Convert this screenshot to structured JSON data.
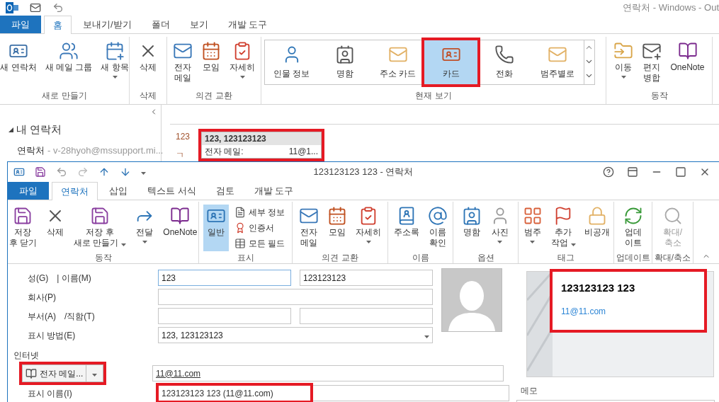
{
  "main_window": {
    "title": "연락처 - Windows - Out",
    "tabs": [
      {
        "label": "파일",
        "kind": "file",
        "selected": false
      },
      {
        "label": "홈",
        "kind": "tab",
        "selected": true
      },
      {
        "label": "보내기/받기",
        "kind": "tab",
        "selected": false
      },
      {
        "label": "폴더",
        "kind": "tab",
        "selected": false
      },
      {
        "label": "보기",
        "kind": "tab",
        "selected": false
      },
      {
        "label": "개발 도구",
        "kind": "tab",
        "selected": false
      }
    ],
    "ribbon_groups": [
      {
        "label": "새로 만들기",
        "kind": "buttons",
        "buttons": [
          {
            "lines": [
              "새 연락처"
            ],
            "dropdown": false
          },
          {
            "lines": [
              "새 메일 그룹"
            ],
            "dropdown": false
          },
          {
            "lines": [
              "새 항목"
            ],
            "dropdown": true
          }
        ]
      },
      {
        "label": "삭제",
        "kind": "buttons",
        "buttons": [
          {
            "lines": [
              "삭제"
            ],
            "dropdown": false
          }
        ]
      },
      {
        "label": "의견 교환",
        "kind": "buttons",
        "buttons": [
          {
            "lines": [
              "전자",
              "메일"
            ],
            "dropdown": false
          },
          {
            "lines": [
              "모임"
            ],
            "dropdown": false
          },
          {
            "lines": [
              "자세히"
            ],
            "dropdown": true
          }
        ]
      },
      {
        "label": "현재 보기",
        "kind": "gallery",
        "views": [
          {
            "label": "인물 정보",
            "selected": false,
            "highlighted": false
          },
          {
            "label": "명함",
            "selected": false,
            "highlighted": false
          },
          {
            "label": "주소 카드",
            "selected": false,
            "highlighted": false
          },
          {
            "label": "카드",
            "selected": true,
            "highlighted": true
          },
          {
            "label": "전화",
            "selected": false,
            "highlighted": false
          },
          {
            "label": "범주별로",
            "selected": false,
            "highlighted": false
          }
        ]
      },
      {
        "label": "동작",
        "kind": "buttons",
        "buttons": [
          {
            "lines": [
              "이동"
            ],
            "dropdown": true
          },
          {
            "lines": [
              "편지",
              "병합"
            ],
            "dropdown": false
          },
          {
            "lines": [
              "OneNote"
            ],
            "dropdown": false
          }
        ]
      }
    ],
    "navigation": {
      "folders": [
        {
          "label": "내 연락처",
          "expanded": true,
          "children": [
            {
              "label": "연락처",
              "account": "- v-28hyoh@mssupport.mi..."
            }
          ]
        }
      ]
    },
    "contact_list": {
      "index_labels": [
        "123",
        "ㄱ"
      ],
      "cards": [
        {
          "title": "123, 123123123",
          "highlighted": true,
          "fields": [
            {
              "label": "전자 메일:",
              "value": "11@1..."
            }
          ]
        }
      ]
    }
  },
  "contact_window": {
    "title": "123123123 123 - 연락처",
    "tabs": [
      {
        "label": "파일",
        "kind": "file",
        "selected": false
      },
      {
        "label": "연락처",
        "kind": "tab",
        "selected": true
      },
      {
        "label": "삽입",
        "kind": "tab",
        "selected": false
      },
      {
        "label": "텍스트 서식",
        "kind": "tab",
        "selected": false
      },
      {
        "label": "검토",
        "kind": "tab",
        "selected": false
      },
      {
        "label": "개발 도구",
        "kind": "tab",
        "selected": false
      }
    ],
    "ribbon_groups": [
      {
        "label": "동작",
        "buttons": [
          {
            "kind": "large",
            "lines": [
              "저장",
              "후 닫기"
            ],
            "dropdown": false
          },
          {
            "kind": "large",
            "lines": [
              "삭제"
            ],
            "dropdown": false
          },
          {
            "kind": "large",
            "lines": [
              "저장 후",
              "새로 만들기"
            ],
            "dropdown": true
          },
          {
            "kind": "large",
            "lines": [
              "전달"
            ],
            "dropdown": true
          },
          {
            "kind": "large",
            "lines": [
              "OneNote"
            ],
            "dropdown": false
          }
        ]
      },
      {
        "label": "표시",
        "buttons": [
          {
            "kind": "large",
            "lines": [
              "일반"
            ],
            "dropdown": false,
            "selected": true
          },
          {
            "kind": "small",
            "lines": [
              "세부 정보"
            ],
            "dropdown": false,
            "selected": false
          },
          {
            "kind": "small",
            "lines": [
              "인증서"
            ],
            "dropdown": false,
            "selected": false
          },
          {
            "kind": "small",
            "lines": [
              "모든 필드"
            ],
            "dropdown": false,
            "selected": false
          }
        ]
      },
      {
        "label": "의견 교환",
        "buttons": [
          {
            "kind": "large",
            "lines": [
              "전자",
              "메일"
            ],
            "dropdown": false
          },
          {
            "kind": "large",
            "lines": [
              "모임"
            ],
            "dropdown": false
          },
          {
            "kind": "large",
            "lines": [
              "자세히"
            ],
            "dropdown": true
          }
        ]
      },
      {
        "label": "이름",
        "buttons": [
          {
            "kind": "large",
            "lines": [
              "주소록"
            ],
            "dropdown": false
          },
          {
            "kind": "large",
            "lines": [
              "이름",
              "확인"
            ],
            "dropdown": false
          }
        ]
      },
      {
        "label": "옵션",
        "buttons": [
          {
            "kind": "large",
            "lines": [
              "명함"
            ],
            "dropdown": false
          },
          {
            "kind": "large",
            "lines": [
              "사진"
            ],
            "dropdown": true
          }
        ]
      },
      {
        "label": "태그",
        "buttons": [
          {
            "kind": "large",
            "lines": [
              "범주"
            ],
            "dropdown": true
          },
          {
            "kind": "large",
            "lines": [
              "추가",
              "작업"
            ],
            "dropdown": true
          },
          {
            "kind": "large",
            "lines": [
              "비공개"
            ],
            "dropdown": false
          }
        ]
      },
      {
        "label": "업데이트",
        "buttons": [
          {
            "kind": "large",
            "lines": [
              "업데",
              "이트"
            ],
            "dropdown": false
          }
        ]
      },
      {
        "label": "확대/축소",
        "buttons": [
          {
            "kind": "large",
            "lines": [
              "확대/",
              "축소"
            ],
            "dropdown": false,
            "disabled": true
          }
        ]
      }
    ],
    "form": {
      "rows": [
        {
          "kind": "pair",
          "labels": [
            "성(G)",
            "| 이름(M)"
          ],
          "inputs": [
            {
              "value": "123",
              "focused": true
            },
            {
              "value": "123123123",
              "focused": false
            }
          ]
        },
        {
          "kind": "single",
          "labels": [
            "회사(P)"
          ],
          "inputs": [
            {
              "focused": false
            }
          ]
        },
        {
          "kind": "pair",
          "labels": [
            "부서(A)",
            "/직함(T)"
          ],
          "inputs": [
            {
              "focused": false
            },
            {
              "focused": false
            }
          ]
        },
        {
          "kind": "combo",
          "labels": [
            "표시 방법(E)"
          ],
          "inputs": [
            {
              "value": "123, 123123123",
              "focused": false
            }
          ]
        }
      ],
      "internet": {
        "label": "인터넷",
        "email": {
          "button": "전자 메일...",
          "value": "11@11.com",
          "highlighted": true
        },
        "display_name": {
          "label": "표시 이름(I)",
          "value": "123123123 123 (11@11.com)",
          "highlighted": true
        }
      }
    },
    "business_card": {
      "name": "123123123 123",
      "email": "11@11.com",
      "highlighted": true
    },
    "notes": {
      "label": "메모"
    }
  }
}
